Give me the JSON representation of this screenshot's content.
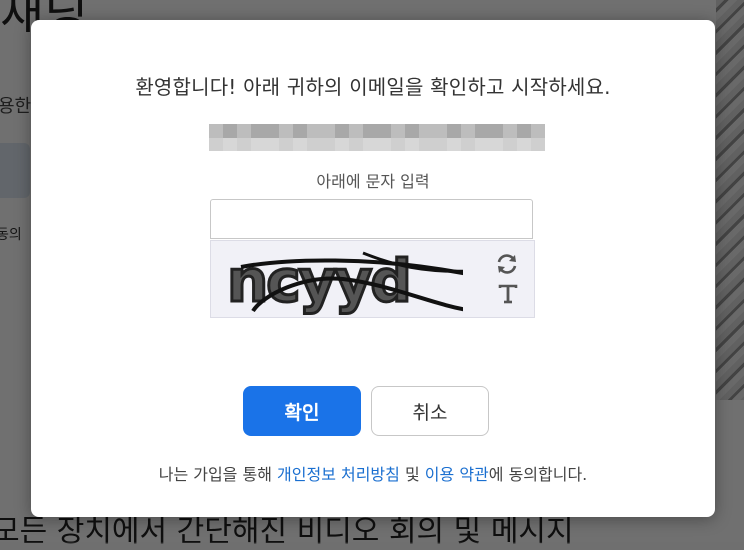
{
  "background": {
    "title": "재닝",
    "subtitle": "용한",
    "agree_text": "동의",
    "footer": "모든 장치에서 간단해진 비디오 회의 및 메시지"
  },
  "modal": {
    "welcome": "환영합니다! 아래 귀하의 이메일을 확인하고 시작하세요.",
    "captcha_label": "아래에 문자 입력",
    "captcha_text": "ncyyd",
    "captcha_input_value": "",
    "confirm_label": "확인",
    "cancel_label": "취소",
    "terms": {
      "prefix": "나는 가입을 통해 ",
      "privacy_link": "개인정보 처리방침",
      "middle": " 및 ",
      "terms_link": "이용 약관",
      "suffix": "에 동의합니다."
    },
    "icons": {
      "refresh": "refresh-icon",
      "audio": "text-mode-icon"
    }
  },
  "colors": {
    "accent": "#1a73e8",
    "link": "#1a6fd0"
  }
}
